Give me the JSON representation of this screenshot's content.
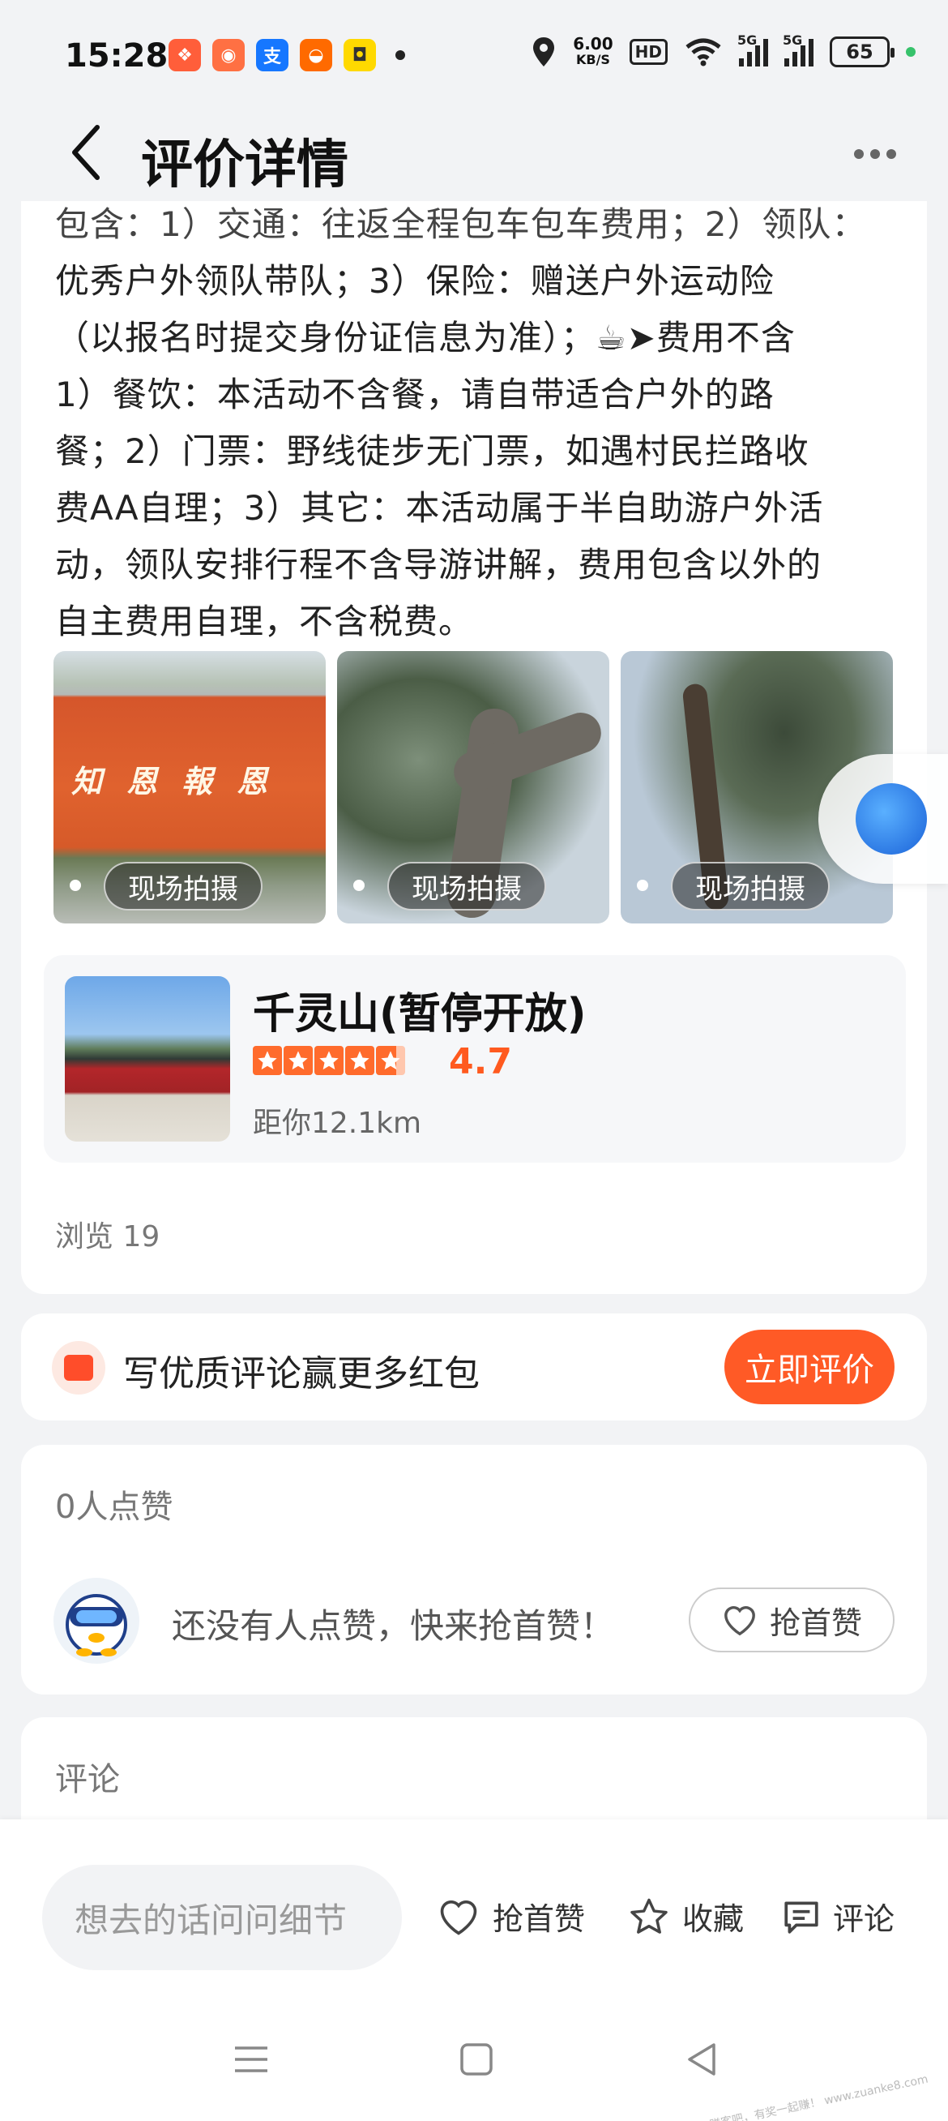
{
  "status_bar": {
    "time": "15:28",
    "net_speed_value": "6.00",
    "net_speed_unit": "KB/S",
    "hd_label": "HD",
    "signal_1_label": "5G",
    "signal_2_label": "5G",
    "battery_level": "65",
    "notification_icons": [
      "app-notification-icon",
      "game-icon",
      "alipay-icon",
      "taobao-icon",
      "xianyu-icon"
    ]
  },
  "nav": {
    "title": "评价详情"
  },
  "review": {
    "lines": [
      "包含：1）交通：往返全程包车包车费用；2）领队：",
      "优秀户外领队带队；3）保险：赠送户外运动险",
      "（以报名时提交身份证信息为准）；☕➤费用不含",
      "1）餐饮：本活动不含餐，请自带适合户外的路",
      "餐；2）门票：野线徒步无门票，如遇村民拦路收",
      "费AA自理；3）其它：本活动属于半自助游户外活",
      "动，领队安排行程不含导游讲解，费用包含以外的",
      "自主费用自理，不含税费。"
    ],
    "photos": [
      {
        "tag": "现场拍摄",
        "sign_text": "知恩報恩"
      },
      {
        "tag": "现场拍摄"
      },
      {
        "tag": "现场拍摄"
      }
    ],
    "views": "浏览 19"
  },
  "poi": {
    "name": "千灵山(暂停开放)",
    "rating": 4.7,
    "rating_text": "4.7",
    "distance": "距你12.1km"
  },
  "promo": {
    "text": "写优质评论赢更多红包",
    "button": "立即评价"
  },
  "likes": {
    "count_text": "0人点赞",
    "empty_text": "还没有人点赞，快来抢首赞！",
    "button": "抢首赞"
  },
  "comments": {
    "title": "评论"
  },
  "bottom_bar": {
    "input_placeholder": "想去的话问问细节",
    "like_label": "抢首赞",
    "fav_label": "收藏",
    "comment_label": "评论"
  },
  "watermark": "赚客吧，有奖一起赚！ www.zuanke8.com",
  "colors": {
    "accent": "#ff5a26",
    "rating": "#ff5a1f",
    "background": "#f2f3f5"
  }
}
